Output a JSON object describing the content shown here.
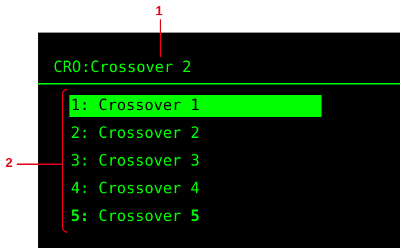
{
  "header": {
    "title": "CRO:Crossover 2"
  },
  "menu": {
    "items": [
      {
        "num": "1:",
        "label": "Crossover",
        "suffix": "1",
        "selected": true,
        "bold": false
      },
      {
        "num": "2:",
        "label": "Crossover",
        "suffix": "2",
        "selected": false,
        "bold": false
      },
      {
        "num": "3:",
        "label": "Crossover",
        "suffix": "3",
        "selected": false,
        "bold": false
      },
      {
        "num": "4:",
        "label": "Crossover",
        "suffix": "4",
        "selected": false,
        "bold": false
      },
      {
        "num": "5:",
        "label": "Crossover",
        "suffix": "5",
        "selected": false,
        "bold": true
      }
    ]
  },
  "annotations": {
    "callout1": "1",
    "callout2": "2"
  },
  "colors": {
    "screen_bg": "#000000",
    "text": "#00ff00",
    "highlight": "#00ff00",
    "annotation": "#e0001b"
  }
}
